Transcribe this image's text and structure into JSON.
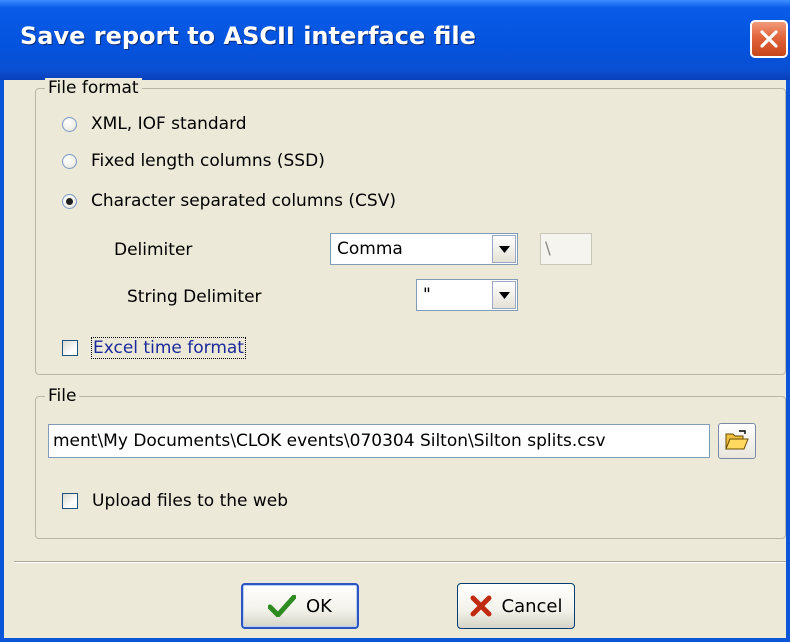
{
  "window": {
    "title": "Save report to ASCII interface file"
  },
  "file_format": {
    "legend": "File format",
    "options": [
      {
        "label": "XML, IOF standard",
        "checked": false
      },
      {
        "label": "Fixed length columns (SSD)",
        "checked": false
      },
      {
        "label": "Character separated columns (CSV)",
        "checked": true
      }
    ],
    "delimiter_label": "Delimiter",
    "delimiter_value": "Comma",
    "delimiter_custom_value": "\\",
    "string_delimiter_label": "String Delimiter",
    "string_delimiter_value": "\"",
    "excel_time_label": "Excel time format",
    "excel_time_checked": false
  },
  "file": {
    "legend": "File",
    "path_value": "ment\\My Documents\\CLOK events\\070304 Silton\\Silton splits.csv",
    "upload_label": "Upload files to the web",
    "upload_checked": false
  },
  "buttons": {
    "ok_label": "OK",
    "cancel_label": "Cancel"
  },
  "colors": {
    "title_bar": "#0453df",
    "ok_check": "#2e8b1f",
    "cancel_x": "#c02a10"
  }
}
